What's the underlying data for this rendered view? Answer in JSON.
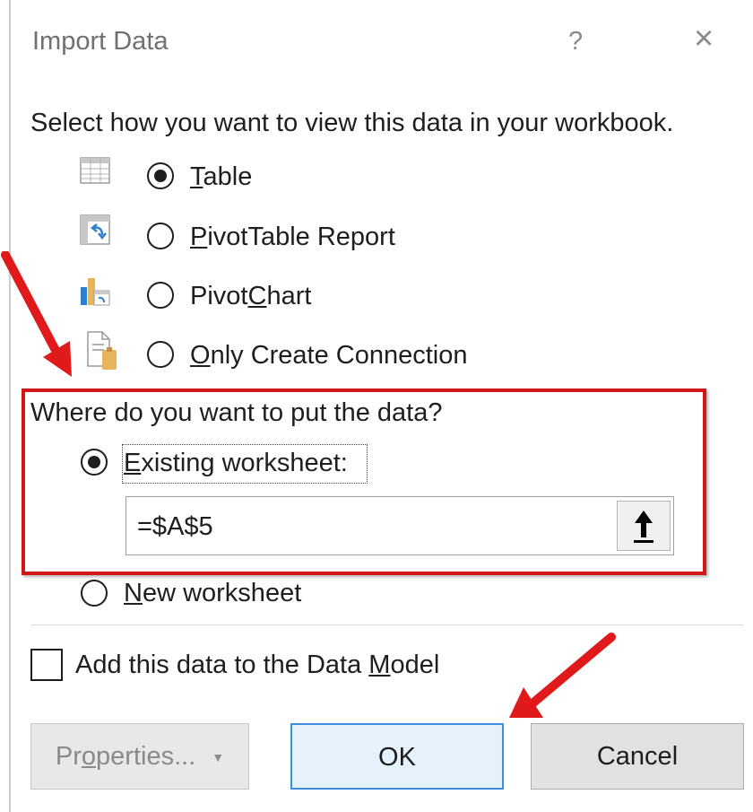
{
  "dialog": {
    "title": "Import Data",
    "help_glyph": "?",
    "close_glyph": "×"
  },
  "view_section": {
    "prompt": "Select how you want to view this data in your workbook.",
    "options": [
      {
        "pre": "",
        "ul": "T",
        "post": "able",
        "icon": "table-icon",
        "selected": true
      },
      {
        "pre": "",
        "ul": "P",
        "post": "ivotTable Report",
        "icon": "pivottable-icon",
        "selected": false
      },
      {
        "pre": "Pivot",
        "ul": "C",
        "post": "hart",
        "icon": "pivotchart-icon",
        "selected": false
      },
      {
        "pre": "",
        "ul": "O",
        "post": "nly Create Connection",
        "icon": "connection-icon",
        "selected": false
      }
    ]
  },
  "location_section": {
    "prompt": "Where do you want to put the data?",
    "existing": {
      "ul": "E",
      "post": "xisting worksheet:",
      "selected": true
    },
    "reference_value": "=$A$5",
    "new": {
      "ul": "N",
      "post": "ew worksheet",
      "selected": false
    }
  },
  "data_model": {
    "pre": "Add this data to the Data ",
    "ul": "M",
    "post": "odel",
    "checked": false
  },
  "buttons": {
    "properties": {
      "pre": "Pr",
      "ul": "o",
      "post": "perties...",
      "caret": "▼"
    },
    "ok": "OK",
    "cancel": "Cancel"
  },
  "colors": {
    "highlight_box": "#d11717",
    "ok_border": "#3c8ddc",
    "annotation_arrow": "#e01a1a"
  }
}
